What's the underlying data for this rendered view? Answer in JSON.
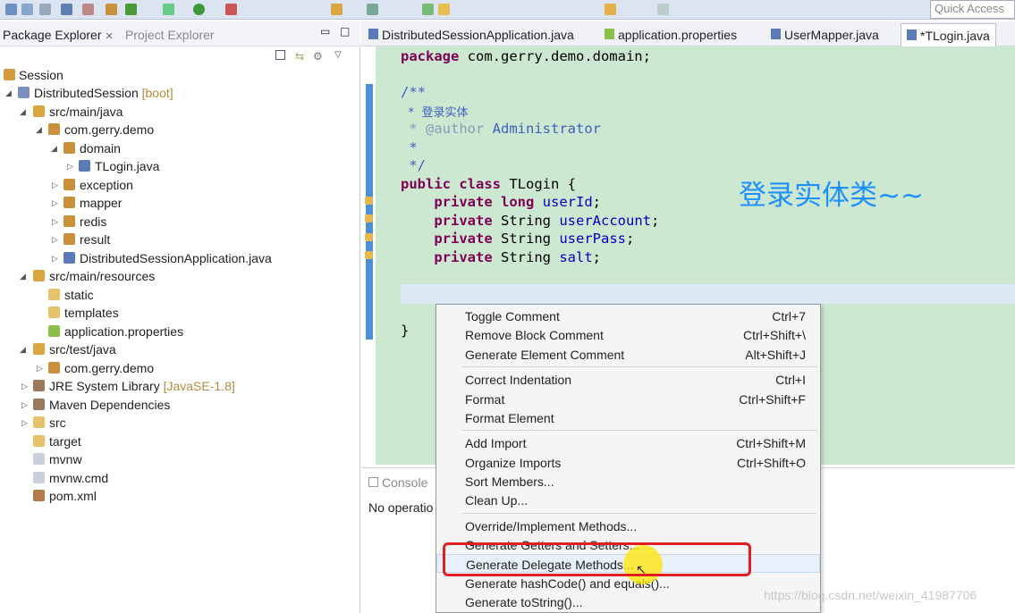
{
  "toolbar": {
    "quick_access": "Quick Access"
  },
  "left_panel": {
    "tabs": [
      {
        "label": "Package Explorer"
      },
      {
        "label": "Project Explorer"
      }
    ]
  },
  "tree": [
    {
      "label": "Session",
      "decor": ""
    },
    {
      "label": "DistributedSession",
      "decor": "[boot]"
    },
    {
      "label": "src/main/java",
      "decor": ""
    },
    {
      "label": "com.gerry.demo",
      "decor": ""
    },
    {
      "label": "domain",
      "decor": ""
    },
    {
      "label": "TLogin.java",
      "decor": ""
    },
    {
      "label": "exception",
      "decor": ""
    },
    {
      "label": "mapper",
      "decor": ""
    },
    {
      "label": "redis",
      "decor": ""
    },
    {
      "label": "result",
      "decor": ""
    },
    {
      "label": "DistributedSessionApplication.java",
      "decor": ""
    },
    {
      "label": "src/main/resources",
      "decor": ""
    },
    {
      "label": "static",
      "decor": ""
    },
    {
      "label": "templates",
      "decor": ""
    },
    {
      "label": "application.properties",
      "decor": ""
    },
    {
      "label": "src/test/java",
      "decor": ""
    },
    {
      "label": "com.gerry.demo",
      "decor": ""
    },
    {
      "label": "JRE System Library",
      "decor": "[JavaSE-1.8]"
    },
    {
      "label": "Maven Dependencies",
      "decor": ""
    },
    {
      "label": "src",
      "decor": ""
    },
    {
      "label": "target",
      "decor": ""
    },
    {
      "label": "mvnw",
      "decor": ""
    },
    {
      "label": "mvnw.cmd",
      "decor": ""
    },
    {
      "label": "pom.xml",
      "decor": ""
    }
  ],
  "editor_tabs": [
    {
      "label": "DistributedSessionApplication.java"
    },
    {
      "label": "application.properties"
    },
    {
      "label": "UserMapper.java"
    },
    {
      "label": "*TLogin.java"
    }
  ],
  "code": {
    "package_kw": "package",
    "package_name": "com.gerry.demo.domain;",
    "doc_open": "/**",
    "doc_line1": " * 登录实体",
    "doc_author_tag": " * @author",
    "doc_author": "Administrator",
    "doc_star": " *",
    "doc_close": " */",
    "class_decl_kw": "public class",
    "class_name": "TLogin {",
    "fields": [
      {
        "kw": "private",
        "type": "long",
        "name": "userId",
        "end": ";"
      },
      {
        "kw": "private",
        "type": "String",
        "name": "userAccount",
        "end": ";"
      },
      {
        "kw": "private",
        "type": "String",
        "name": "userPass",
        "end": ";"
      },
      {
        "kw": "private",
        "type": "String",
        "name": "salt",
        "end": ";"
      }
    ],
    "close": "}"
  },
  "overlay_text": "登录实体类~~",
  "console": {
    "tab": "Console",
    "message": "No operatio"
  },
  "context_menu": [
    {
      "label": "Toggle Comment",
      "shortcut": "Ctrl+7"
    },
    {
      "label": "Remove Block Comment",
      "shortcut": "Ctrl+Shift+\\"
    },
    {
      "label": "Generate Element Comment",
      "shortcut": "Alt+Shift+J"
    },
    {
      "label": "Correct Indentation",
      "shortcut": "Ctrl+I"
    },
    {
      "label": "Format",
      "shortcut": "Ctrl+Shift+F"
    },
    {
      "label": "Format Element",
      "shortcut": ""
    },
    {
      "label": "Add Import",
      "shortcut": "Ctrl+Shift+M"
    },
    {
      "label": "Organize Imports",
      "shortcut": "Ctrl+Shift+O"
    },
    {
      "label": "Sort Members...",
      "shortcut": ""
    },
    {
      "label": "Clean Up...",
      "shortcut": ""
    },
    {
      "label": "Override/Implement Methods...",
      "shortcut": ""
    },
    {
      "label": "Generate Getters and Setters...",
      "shortcut": ""
    },
    {
      "label": "Generate Delegate Methods...",
      "shortcut": ""
    },
    {
      "label": "Generate hashCode() and equals()...",
      "shortcut": ""
    },
    {
      "label": "Generate toString()...",
      "shortcut": ""
    }
  ],
  "watermark": "https://blog.csdn.net/weixin_41987706"
}
